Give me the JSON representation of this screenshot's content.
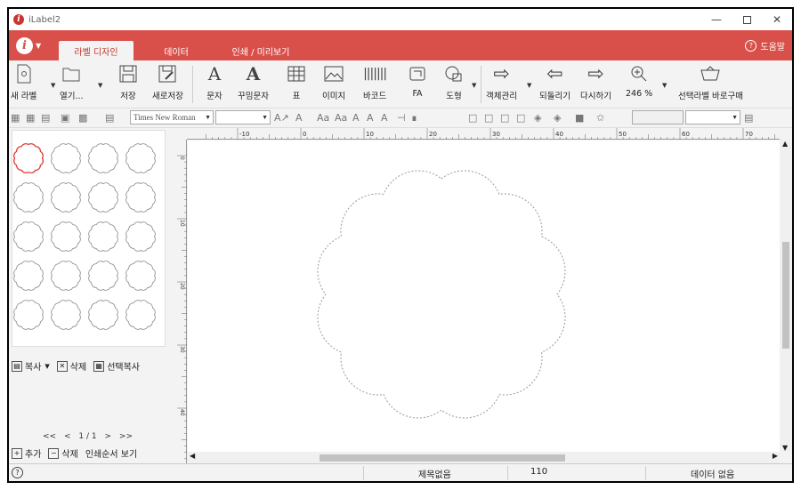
{
  "window": {
    "title": "iLabel2"
  },
  "menubar": {
    "tabs": [
      {
        "label": "라벨 디자인",
        "active": true
      },
      {
        "label": "데이터",
        "active": false
      },
      {
        "label": "인쇄 / 미리보기",
        "active": false
      }
    ],
    "help_label": "도움말"
  },
  "ribbon": {
    "buttons": [
      {
        "label": "새 라벨",
        "icon": "new-label-icon"
      },
      {
        "label": "열기...",
        "icon": "open-icon"
      },
      {
        "label": "저장",
        "icon": "save-icon"
      },
      {
        "label": "새로저장",
        "icon": "save-as-icon"
      },
      {
        "label": "문자",
        "icon": "text-icon"
      },
      {
        "label": "꾸밈문자",
        "icon": "fancy-text-icon"
      },
      {
        "label": "표",
        "icon": "table-icon"
      },
      {
        "label": "이미지",
        "icon": "image-icon"
      },
      {
        "label": "바코드",
        "icon": "barcode-icon"
      },
      {
        "label": "FA",
        "icon": "fa-icon"
      },
      {
        "label": "도형",
        "icon": "shape-icon"
      },
      {
        "label": "객체관리",
        "icon": "object-manage-icon"
      },
      {
        "label": "되돌리기",
        "icon": "undo-icon"
      },
      {
        "label": "다시하기",
        "icon": "redo-icon"
      },
      {
        "label": "246 %",
        "icon": "zoom-icon"
      },
      {
        "label": "선택라벨 바로구매",
        "icon": "cart-icon"
      }
    ]
  },
  "format_bar": {
    "font_name": "Times New Roman"
  },
  "left_panel": {
    "actions": {
      "copy": "복사",
      "delete": "삭제",
      "select_copy": "선택복사"
    },
    "pager": {
      "first": "<<",
      "prev": "<",
      "page": "1 / 1",
      "next": ">",
      "last": ">>"
    },
    "bottom": {
      "add": "추가",
      "delete": "삭제",
      "print_order": "인쇄순서 보기"
    }
  },
  "ruler": {
    "top_labels": [
      "-10",
      "0",
      "10",
      "20",
      "30",
      "40",
      "50",
      "60",
      "70"
    ],
    "left_labels": [
      "0",
      "10",
      "20",
      "30",
      "40"
    ]
  },
  "statusbar": {
    "title": "제목없음",
    "number": "110",
    "data": "데이터 없음"
  },
  "colors": {
    "accent": "#d9504a",
    "selected_outline": "#e0413a"
  }
}
